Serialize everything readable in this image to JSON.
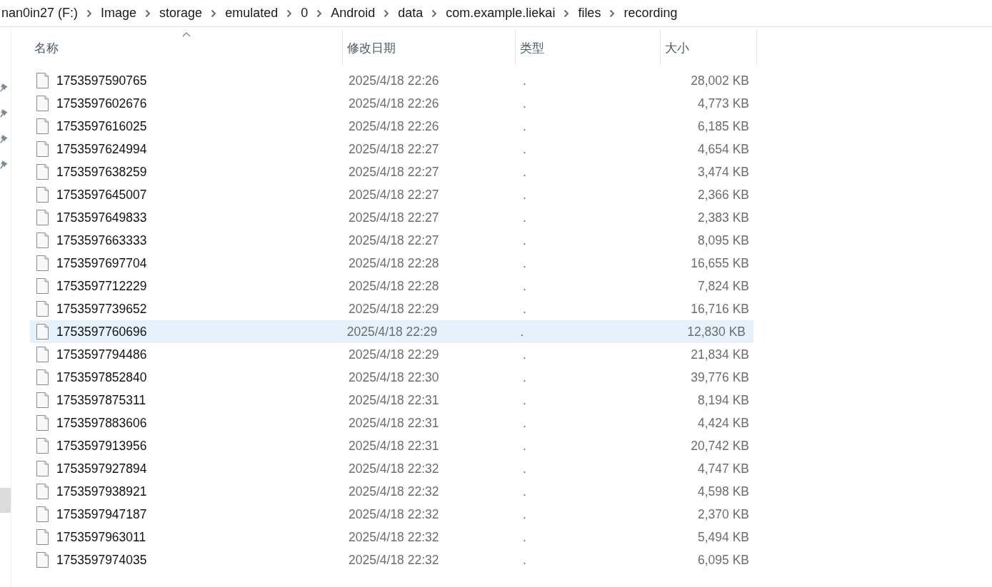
{
  "breadcrumb": [
    "nan0in27 (F:)",
    "Image",
    "storage",
    "emulated",
    "0",
    "Android",
    "data",
    "com.example.liekai",
    "files",
    "recording"
  ],
  "table": {
    "columns": [
      {
        "label": "名称",
        "sorted": true
      },
      {
        "label": "修改日期",
        "sorted": false
      },
      {
        "label": "类型",
        "sorted": false
      },
      {
        "label": "大小",
        "sorted": false
      }
    ],
    "rows": [
      {
        "name": "1753597590765",
        "date": "2025/4/18 22:26",
        "type": ".",
        "size": "28,002 KB",
        "selected": false
      },
      {
        "name": "1753597602676",
        "date": "2025/4/18 22:26",
        "type": ".",
        "size": "4,773 KB",
        "selected": false
      },
      {
        "name": "1753597616025",
        "date": "2025/4/18 22:26",
        "type": ".",
        "size": "6,185 KB",
        "selected": false
      },
      {
        "name": "1753597624994",
        "date": "2025/4/18 22:27",
        "type": ".",
        "size": "4,654 KB",
        "selected": false
      },
      {
        "name": "1753597638259",
        "date": "2025/4/18 22:27",
        "type": ".",
        "size": "3,474 KB",
        "selected": false
      },
      {
        "name": "1753597645007",
        "date": "2025/4/18 22:27",
        "type": ".",
        "size": "2,366 KB",
        "selected": false
      },
      {
        "name": "1753597649833",
        "date": "2025/4/18 22:27",
        "type": ".",
        "size": "2,383 KB",
        "selected": false
      },
      {
        "name": "1753597663333",
        "date": "2025/4/18 22:27",
        "type": ".",
        "size": "8,095 KB",
        "selected": false
      },
      {
        "name": "1753597697704",
        "date": "2025/4/18 22:28",
        "type": ".",
        "size": "16,655 KB",
        "selected": false
      },
      {
        "name": "1753597712229",
        "date": "2025/4/18 22:28",
        "type": ".",
        "size": "7,824 KB",
        "selected": false
      },
      {
        "name": "1753597739652",
        "date": "2025/4/18 22:29",
        "type": ".",
        "size": "16,716 KB",
        "selected": false
      },
      {
        "name": "1753597760696",
        "date": "2025/4/18 22:29",
        "type": ".",
        "size": "12,830 KB",
        "selected": true
      },
      {
        "name": "1753597794486",
        "date": "2025/4/18 22:29",
        "type": ".",
        "size": "21,834 KB",
        "selected": false
      },
      {
        "name": "1753597852840",
        "date": "2025/4/18 22:30",
        "type": ".",
        "size": "39,776 KB",
        "selected": false
      },
      {
        "name": "1753597875311",
        "date": "2025/4/18 22:31",
        "type": ".",
        "size": "8,194 KB",
        "selected": false
      },
      {
        "name": "1753597883606",
        "date": "2025/4/18 22:31",
        "type": ".",
        "size": "4,424 KB",
        "selected": false
      },
      {
        "name": "1753597913956",
        "date": "2025/4/18 22:31",
        "type": ".",
        "size": "20,742 KB",
        "selected": false
      },
      {
        "name": "1753597927894",
        "date": "2025/4/18 22:32",
        "type": ".",
        "size": "4,747 KB",
        "selected": false
      },
      {
        "name": "1753597938921",
        "date": "2025/4/18 22:32",
        "type": ".",
        "size": "4,598 KB",
        "selected": false
      },
      {
        "name": "1753597947187",
        "date": "2025/4/18 22:32",
        "type": ".",
        "size": "2,370 KB",
        "selected": false
      },
      {
        "name": "1753597963011",
        "date": "2025/4/18 22:32",
        "type": ".",
        "size": "5,494 KB",
        "selected": false
      },
      {
        "name": "1753597974035",
        "date": "2025/4/18 22:32",
        "type": ".",
        "size": "6,095 KB",
        "selected": false
      }
    ]
  }
}
